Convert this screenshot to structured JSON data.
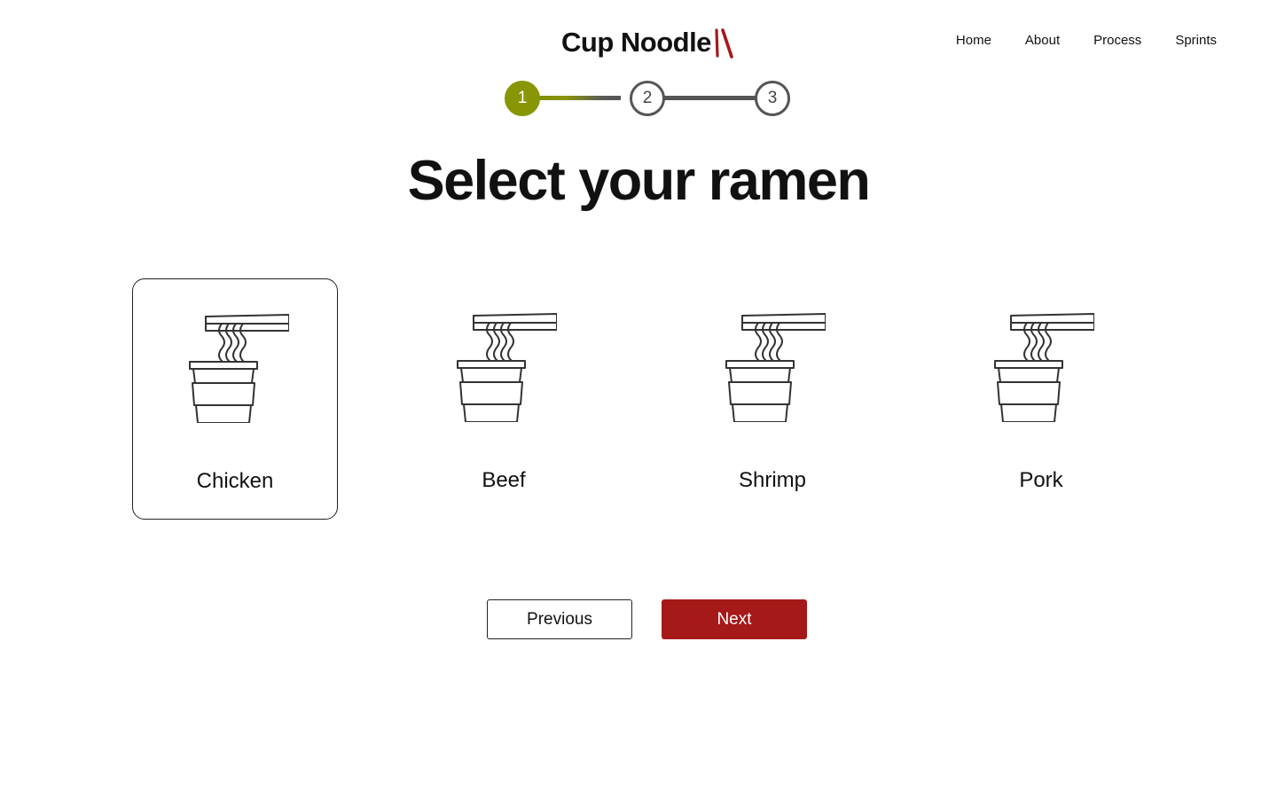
{
  "header": {
    "brand": "Cup Noodle",
    "brand_accent": "#a51919",
    "nav": [
      "Home",
      "About",
      "Process",
      "Sprints"
    ]
  },
  "stepper": {
    "steps": [
      "1",
      "2",
      "3"
    ],
    "current_step": 1,
    "active_color": "#889606"
  },
  "main": {
    "title": "Select your ramen",
    "options": [
      {
        "label": "Chicken",
        "icon": "cup-noodle-icon",
        "selected": true
      },
      {
        "label": "Beef",
        "icon": "cup-noodle-icon",
        "selected": false
      },
      {
        "label": "Shrimp",
        "icon": "cup-noodle-icon",
        "selected": false
      },
      {
        "label": "Pork",
        "icon": "cup-noodle-icon",
        "selected": false
      }
    ]
  },
  "actions": {
    "previous_label": "Previous",
    "next_label": "Next",
    "next_color": "#a51919"
  }
}
